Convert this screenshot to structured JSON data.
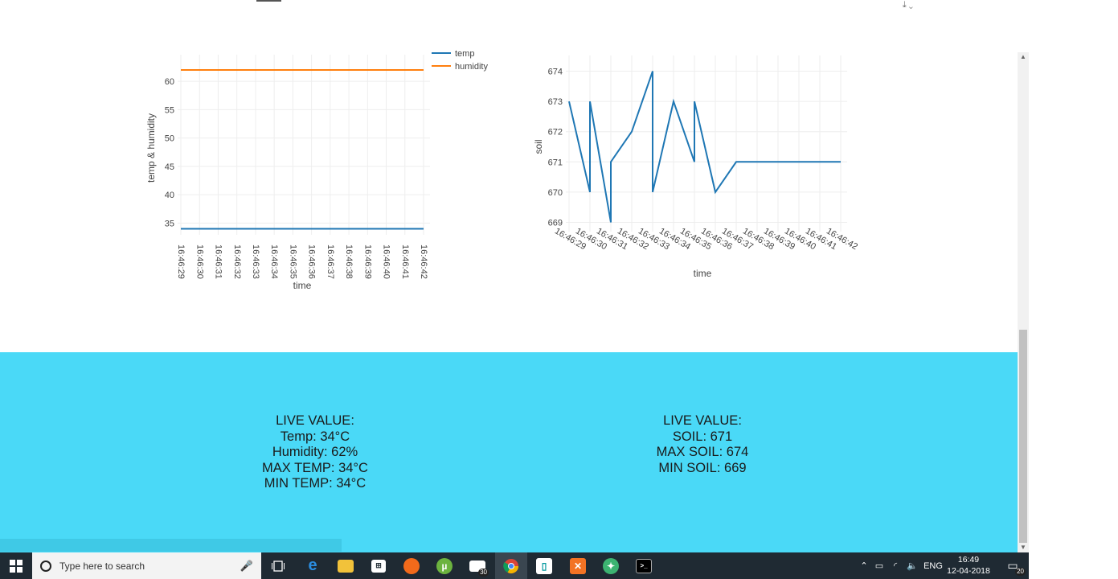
{
  "top_icons": "⤓  ⌄",
  "chart_data": [
    {
      "type": "line",
      "ylabel": "temp & humidity",
      "xlabel": "time",
      "ylim": [
        33.5,
        63
      ],
      "yticks": [
        35,
        40,
        45,
        50,
        55,
        60
      ],
      "categories": [
        "16:46:29",
        "16:46:30",
        "16:46:31",
        "16:46:32",
        "16:46:33",
        "16:46:34",
        "16:46:35",
        "16:46:36",
        "16:46:37",
        "16:46:38",
        "16:46:39",
        "16:46:40",
        "16:46:41",
        "16:46:42"
      ],
      "series": [
        {
          "name": "temp",
          "color": "#1f77b4",
          "values": [
            34,
            34,
            34,
            34,
            34,
            34,
            34,
            34,
            34,
            34,
            34,
            34,
            34,
            34
          ]
        },
        {
          "name": "humidity",
          "color": "#ff7f0e",
          "values": [
            62,
            62,
            62,
            62,
            62,
            62,
            62,
            62,
            62,
            62,
            62,
            62,
            62,
            62
          ]
        }
      ],
      "legend": "top-right",
      "grid": true
    },
    {
      "type": "line",
      "ylabel": "soil",
      "xlabel": "time",
      "ylim": [
        668.8,
        674.2
      ],
      "yticks": [
        669,
        670,
        671,
        672,
        673,
        674
      ],
      "categories": [
        "16:46:29",
        "16:46:30",
        "16:46:31",
        "16:46:32",
        "16:46:33",
        "16:46:34",
        "16:46:35",
        "16:46:36",
        "16:46:37",
        "16:46:38",
        "16:46:39",
        "16:46:40",
        "16:46:41",
        "16:46:42"
      ],
      "x": [
        0,
        1,
        1,
        2,
        2,
        3,
        4,
        4,
        5,
        6,
        6,
        7,
        8,
        13
      ],
      "series": [
        {
          "name": "soil",
          "color": "#1f77b4",
          "values": [
            673,
            670,
            673,
            669,
            671,
            672,
            674,
            670,
            673,
            671,
            673,
            670,
            671,
            671
          ]
        }
      ],
      "grid": true
    }
  ],
  "live_left": {
    "title": "LIVE VALUE:",
    "temp": "Temp: 34°C",
    "humidity": "Humidity: 62%",
    "max_temp": "MAX TEMP: 34°C",
    "min_temp": "MIN TEMP: 34°C"
  },
  "live_right": {
    "title": "LIVE VALUE:",
    "soil": "SOIL: 671",
    "max_soil": "MAX SOIL: 674",
    "min_soil": "MIN SOIL: 669"
  },
  "taskbar": {
    "search_placeholder": "Type here to search",
    "mail_badge": "30",
    "lang": "ENG",
    "time": "16:49",
    "date": "12-04-2018",
    "notif_count": "20"
  },
  "colors": {
    "live_panel": "#4ad9f7",
    "taskbar": "#1f2a33"
  }
}
